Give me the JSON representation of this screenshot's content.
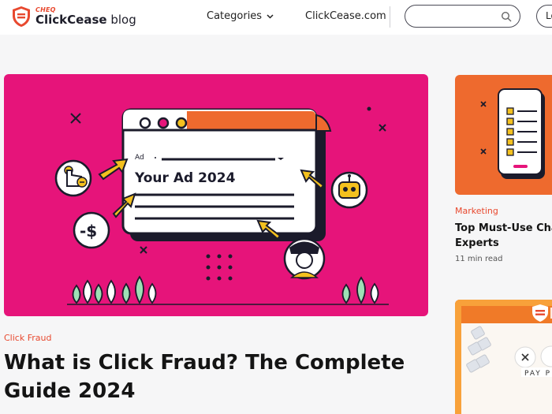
{
  "header": {
    "logo_small": "CHEQ",
    "logo_brand": "ClickCease",
    "logo_suffix": " blog",
    "nav_categories": "Categories",
    "nav_site": "ClickCease.com",
    "search_placeholder": "",
    "login_label": "Lo"
  },
  "hero": {
    "illustration": {
      "ad_tag": "Ad",
      "ad_headline": "Your Ad 2024",
      "money_symbol": "-$"
    },
    "category": "Click Fraud",
    "title": "What is Click Fraud? The Complete Guide 2024"
  },
  "cards": [
    {
      "category": "Marketing",
      "title_line1": "Top Must-Use Chat",
      "title_line2": "Experts",
      "read_time": "11 min read"
    },
    {
      "image_caption": "PAY P"
    }
  ],
  "colors": {
    "accent": "#e8492f",
    "hero_bg": "#e6147a",
    "card_orange": "#ee6a2e",
    "text": "#141414"
  }
}
